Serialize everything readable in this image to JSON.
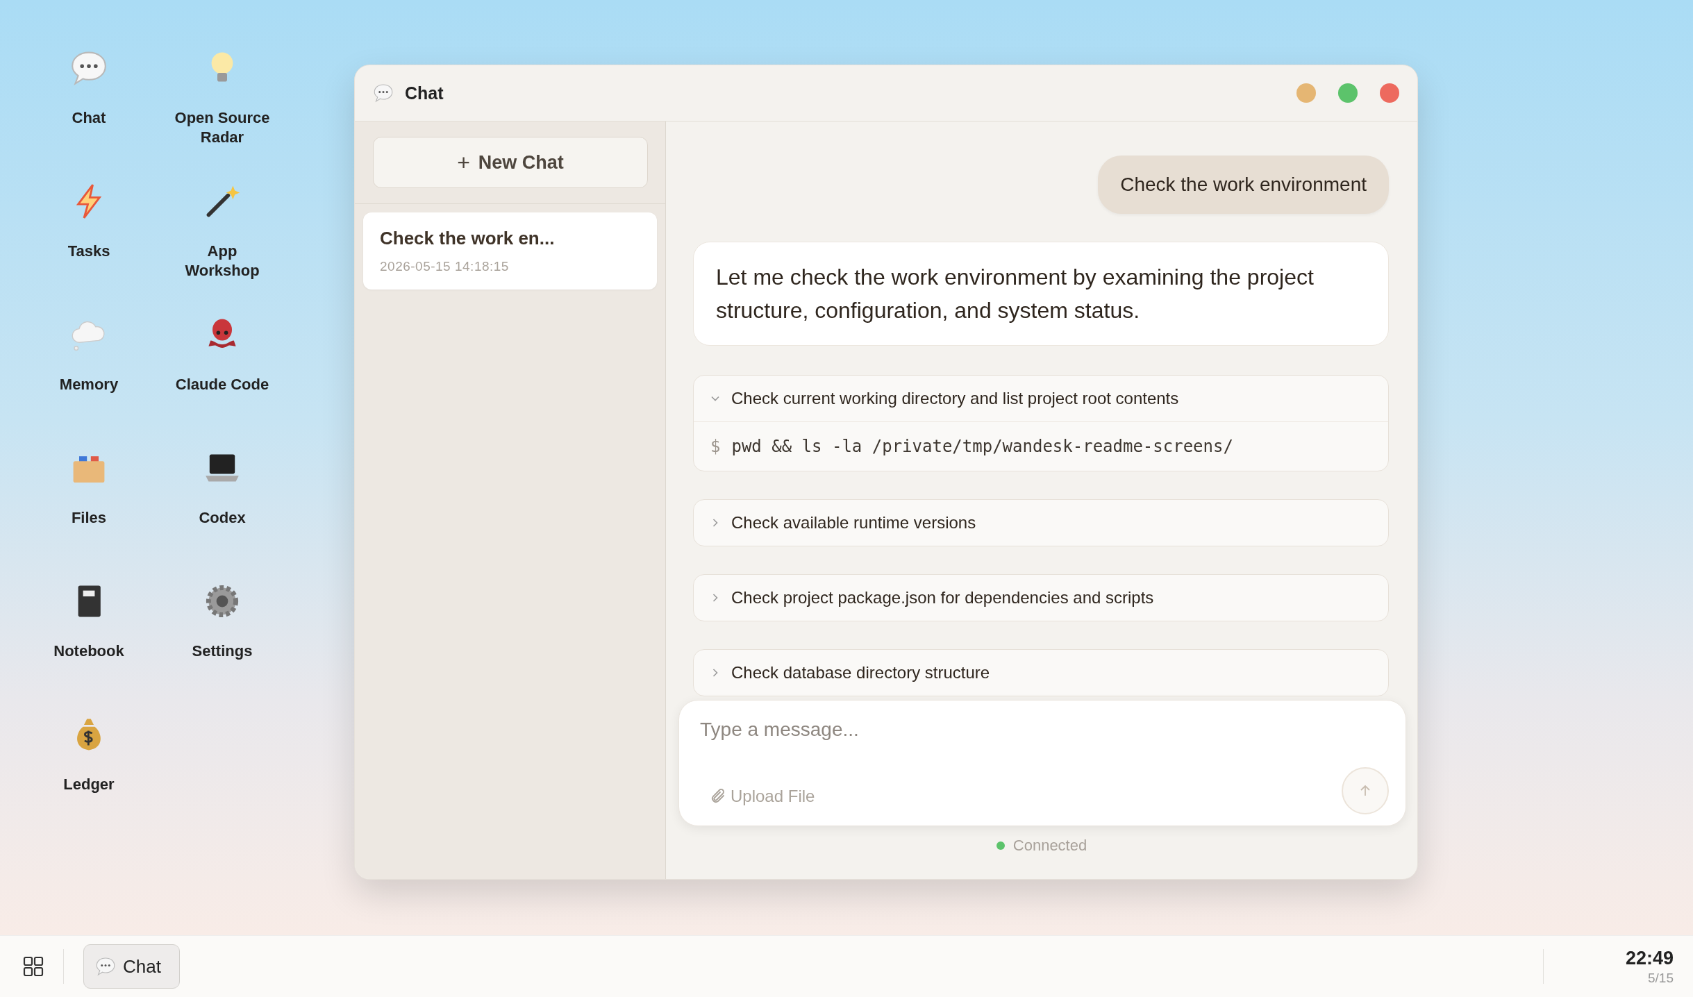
{
  "desktop": {
    "icons": [
      {
        "label": "Chat"
      },
      {
        "label": "Open Source Radar"
      },
      {
        "label": "Tasks"
      },
      {
        "label": "App Workshop"
      },
      {
        "label": "Memory"
      },
      {
        "label": "Claude Code"
      },
      {
        "label": "Files"
      },
      {
        "label": "Codex"
      },
      {
        "label": "Notebook"
      },
      {
        "label": "Settings"
      },
      {
        "label": "Ledger"
      }
    ]
  },
  "window": {
    "title": "Chat"
  },
  "sidebar": {
    "new_chat_button": "+ New Chat",
    "conversations": [
      {
        "title": "Check the work en...",
        "time": "2026-05-15 14:18:15",
        "selected": true
      }
    ]
  },
  "messages": [
    {
      "kind": "user",
      "text": "Check the work environment"
    },
    {
      "kind": "assistant",
      "text": "Let me check the work environment by examining the project structure, configuration, and system status."
    }
  ],
  "steps": [
    {
      "title": "Check current working directory and list project root contents",
      "expanded": true,
      "prompt": "$",
      "command": "pwd && ls -la /private/tmp/wandesk-readme-screens/"
    },
    {
      "title": "Check available runtime versions",
      "expanded": false
    },
    {
      "title": "Check project package.json for dependencies and scripts",
      "expanded": false
    },
    {
      "title": "Check database directory structure",
      "expanded": false
    }
  ],
  "composer": {
    "placeholder": "Type a message...",
    "upload_label": "Upload File"
  },
  "status": {
    "label": "Connected",
    "connected": true
  },
  "taskbar": {
    "apps": [
      {
        "label": "Chat",
        "selected": true
      }
    ],
    "clock": {
      "time": "22:49",
      "date": "5/15"
    }
  }
}
